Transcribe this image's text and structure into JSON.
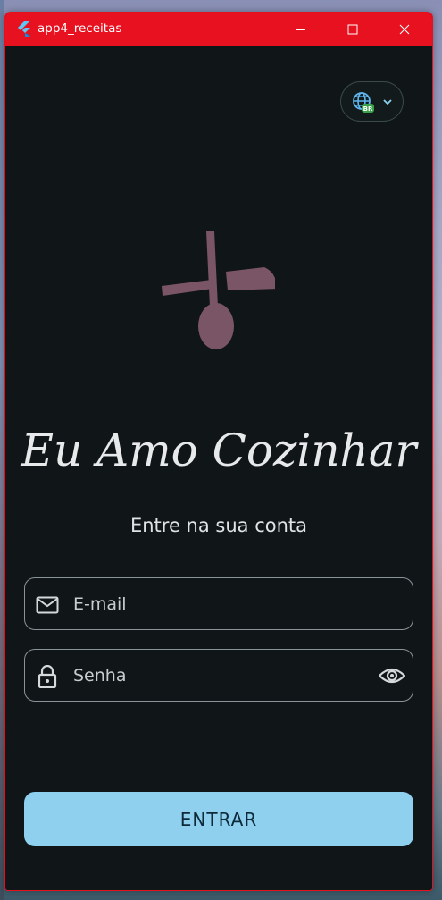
{
  "window": {
    "title": "app4_receitas",
    "accent_color": "#e8111f",
    "controls": [
      "minimize-icon",
      "maximize-icon",
      "close-icon"
    ]
  },
  "language_selector": {
    "icon": "globe-icon",
    "badge": "BR",
    "dropdown_icon": "chevron-down-icon"
  },
  "brand": {
    "logo_icon": "utensils-icon",
    "title": "Eu Amo Cozinhar",
    "subtitle": "Entre na sua conta"
  },
  "form": {
    "email": {
      "placeholder": "E-mail",
      "icon": "mail-icon",
      "value": ""
    },
    "password": {
      "placeholder": "Senha",
      "icon": "lock-icon",
      "toggle_icon": "eye-icon",
      "value": ""
    },
    "submit_label": "ENTRAR"
  },
  "colors": {
    "background": "#101518",
    "button": "#8ed0ee",
    "logo": "#7a5566",
    "field_border": "#8a9397"
  }
}
